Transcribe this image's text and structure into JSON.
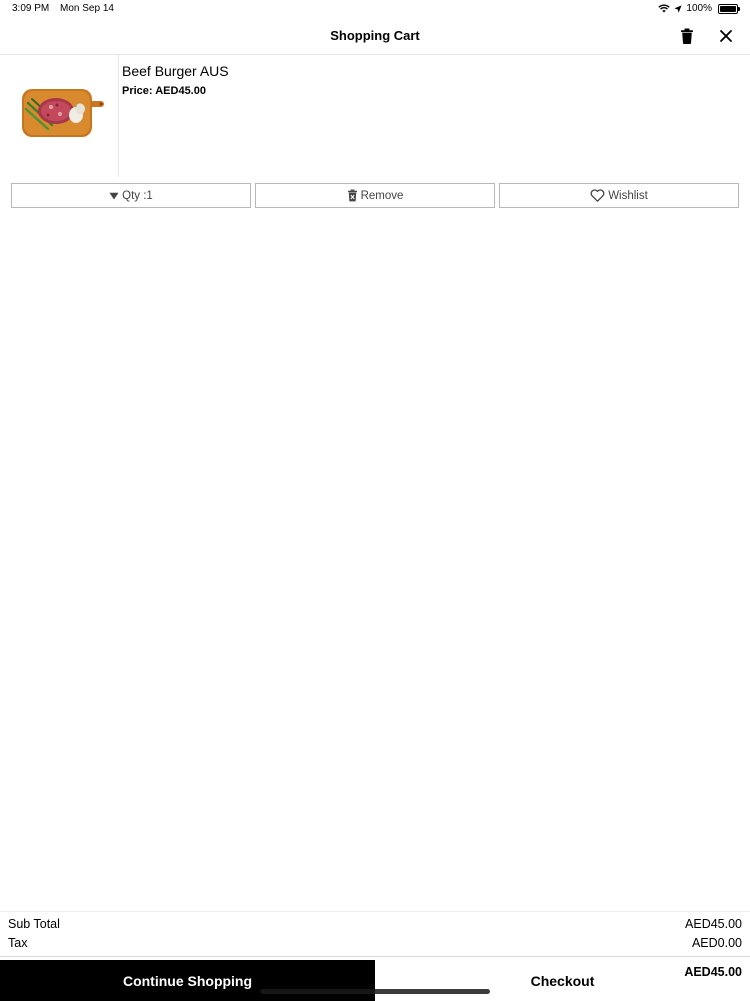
{
  "status_bar": {
    "time": "3:09 PM",
    "date": "Mon Sep 14",
    "battery": "100%",
    "battery_level": 1.0,
    "icons": [
      "wifi-icon",
      "location-icon",
      "battery-icon"
    ]
  },
  "header": {
    "title": "Shopping Cart",
    "icons": [
      "trash-icon",
      "close-icon"
    ]
  },
  "cart": {
    "items": [
      {
        "name": "Beef Burger AUS",
        "price_label": "Price: AED45.00",
        "qty_label": "Qty :1",
        "remove_label": "Remove",
        "wishlist_label": "Wishlist"
      }
    ]
  },
  "totals": {
    "subtotal_label": "Sub Total",
    "subtotal_value": "AED45.00",
    "tax_label": "Tax",
    "tax_value": "AED0.00",
    "grand_total": "AED45.00"
  },
  "footer": {
    "continue_label": "Continue Shopping",
    "checkout_label": "Checkout"
  },
  "colors": {
    "primary": "#000000",
    "background": "#ffffff",
    "border": "#b8b8b8"
  }
}
